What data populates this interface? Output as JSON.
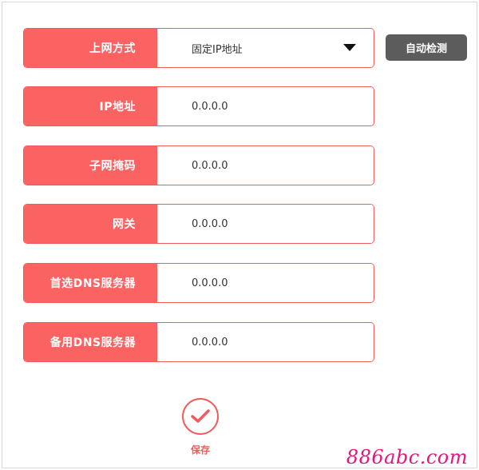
{
  "form": {
    "connection_type": {
      "label": "上网方式",
      "value": "固定IP地址"
    },
    "detect_button": "自动检测",
    "fields": [
      {
        "label": "IP地址",
        "value": "0.0.0.0"
      },
      {
        "label": "子网掩码",
        "value": "0.0.0.0"
      },
      {
        "label": "网关",
        "value": "0.0.0.0"
      },
      {
        "label": "首选DNS服务器",
        "value": "0.0.0.0"
      },
      {
        "label": "备用DNS服务器",
        "value": "0.0.0.0"
      }
    ],
    "save_label": "保存"
  },
  "watermark": "886abc.com",
  "colors": {
    "accent": "#fb6262",
    "border": "#f15a5a",
    "button_dark": "#5c5c5c",
    "watermark": "#e8157c"
  },
  "icons": {
    "select_caret": "triangle-down-icon",
    "save": "check-circle-icon"
  }
}
